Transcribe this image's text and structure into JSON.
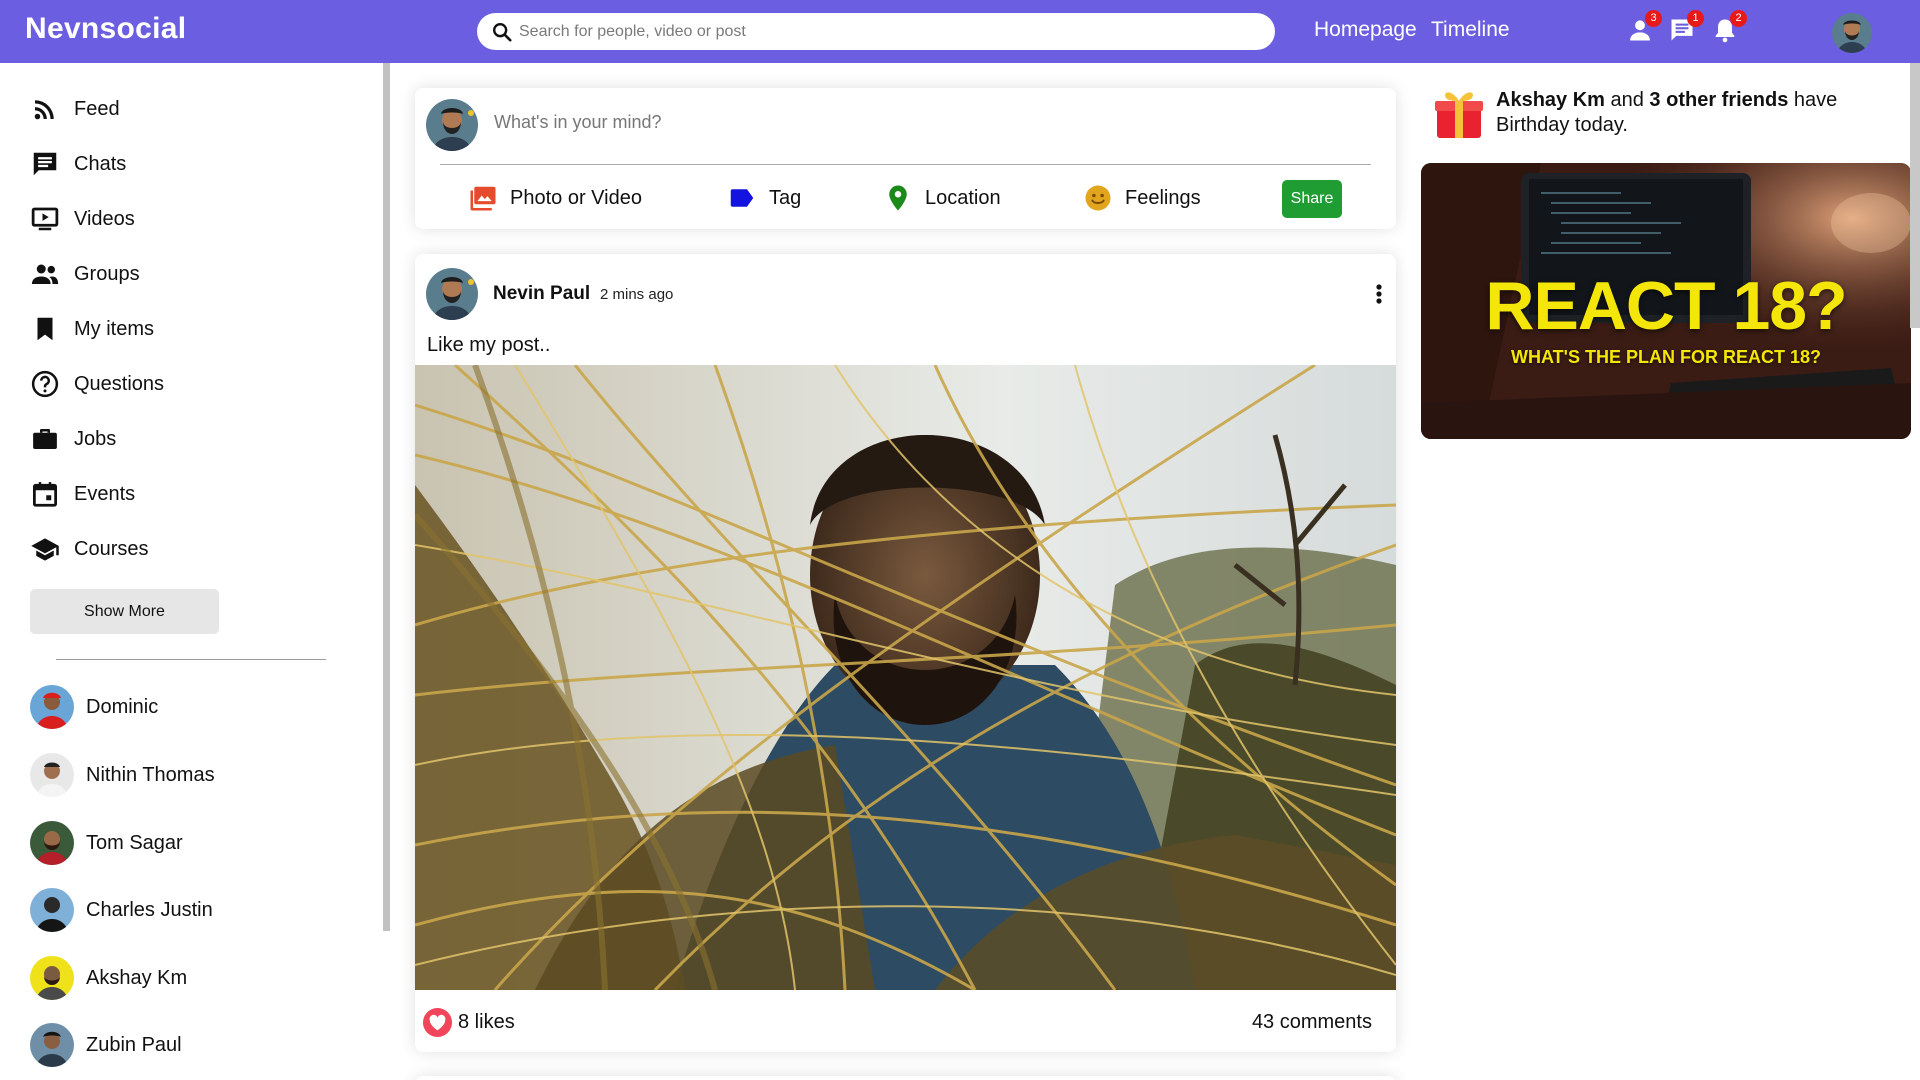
{
  "app": {
    "logo": "Nevnsocial"
  },
  "topbar": {
    "search_placeholder": "Search for people, video or post",
    "links": [
      "Homepage",
      "Timeline"
    ],
    "badges": {
      "friend_requests": "3",
      "messages": "1",
      "notifications": "2"
    }
  },
  "sidebar": {
    "items": [
      {
        "label": "Feed",
        "icon": "rss-feed-icon"
      },
      {
        "label": "Chats",
        "icon": "chat-icon"
      },
      {
        "label": "Videos",
        "icon": "video-icon"
      },
      {
        "label": "Groups",
        "icon": "group-icon"
      },
      {
        "label": "My items",
        "icon": "bookmark-icon"
      },
      {
        "label": "Questions",
        "icon": "help-icon"
      },
      {
        "label": "Jobs",
        "icon": "work-icon"
      },
      {
        "label": "Events",
        "icon": "event-icon"
      },
      {
        "label": "Courses",
        "icon": "school-icon"
      }
    ],
    "show_more": "Show More",
    "friends": [
      "Dominic",
      "Nithin Thomas",
      "Tom Sagar",
      "Charles Justin",
      "Akshay Km",
      "Zubin Paul"
    ]
  },
  "share": {
    "placeholder": "What's in your mind?",
    "options": [
      "Photo or Video",
      "Tag",
      "Location",
      "Feelings"
    ],
    "button": "Share"
  },
  "post": {
    "author": "Nevin Paul",
    "time": "2 mins ago",
    "text": "Like my post..",
    "likes": "8 likes",
    "comments": "43 comments"
  },
  "rightbar": {
    "birthday": {
      "name": "Akshay Km",
      "connector": " and ",
      "others": "3 other friends",
      "suffix": " have Birthday today."
    },
    "ad": {
      "title": "REACT 18?",
      "subtitle": "WHAT'S THE PLAN FOR REACT 18?"
    }
  },
  "colors": {
    "topbar": "#6b5ee0",
    "share_button": "#1f9d32",
    "badge": "#e81919",
    "ad_text": "#f5e60a"
  }
}
